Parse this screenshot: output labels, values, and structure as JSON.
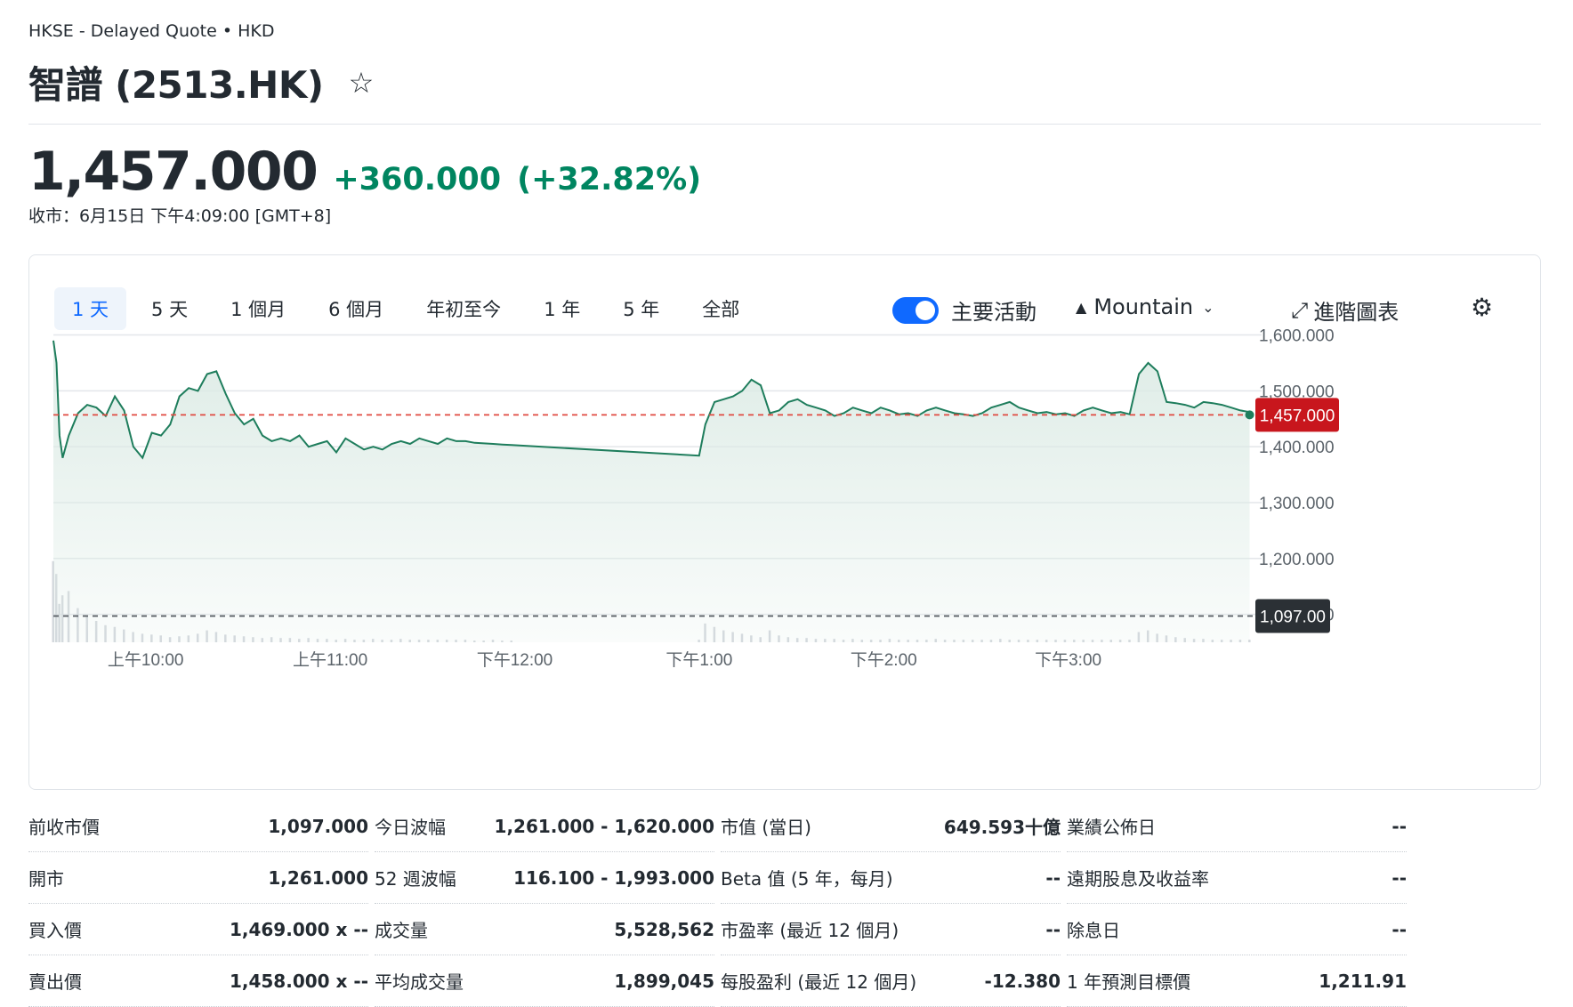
{
  "header": {
    "exchange_line": "HKSE - Delayed Quote • HKD",
    "title": "智譜 (2513.HK)",
    "star_icon": "star-outline-icon"
  },
  "quote": {
    "price": "1,457.000",
    "change": "+360.000",
    "change_pct": "(+32.82%)",
    "close_time": "收市：6月15日 下午4:09:00 [GMT+8]",
    "up_color": "#008560"
  },
  "chart_controls": {
    "ranges": [
      "1 天",
      "5 天",
      "1 個月",
      "6 個月",
      "年初至今",
      "1 年",
      "5 年",
      "全部"
    ],
    "active_range": "1 天",
    "key_events_label": "主要活動",
    "key_events_on": true,
    "chart_type_icon": "mountain-icon",
    "chart_type_label": "Mountain",
    "advanced_label": "進階圖表",
    "advanced_icon": "expand-arrow-icon",
    "settings_icon": "gear-icon"
  },
  "chart_data": {
    "type": "area",
    "x_labels": [
      "上午10:00",
      "上午11:00",
      "下午12:00",
      "下午1:00",
      "下午2:00",
      "下午3:00"
    ],
    "y_ticks": [
      "1,600.000",
      "1,500.000",
      "1,400.000",
      "1,300.000",
      "1,200.000",
      "1,100.000"
    ],
    "y_tick_values": [
      1600,
      1500,
      1400,
      1300,
      1200,
      1100
    ],
    "ylim": [
      1050,
      1620
    ],
    "current_price_label": "1,457.000",
    "current_price": 1457,
    "prev_close_label": "1,097.00",
    "prev_close": 1097,
    "line_color": "#1e7d5c",
    "fill_color": "#dcebe5",
    "current_badge_color": "#c8161d",
    "prev_badge_color": "#2b3035",
    "times": [
      "09:30",
      "09:31",
      "09:32",
      "09:33",
      "09:35",
      "09:38",
      "09:41",
      "09:44",
      "09:47",
      "09:50",
      "09:53",
      "09:56",
      "09:59",
      "10:02",
      "10:05",
      "10:08",
      "10:11",
      "10:14",
      "10:17",
      "10:20",
      "10:23",
      "10:26",
      "10:29",
      "10:32",
      "10:35",
      "10:38",
      "10:41",
      "10:44",
      "10:47",
      "10:50",
      "10:53",
      "10:56",
      "10:59",
      "11:02",
      "11:05",
      "11:08",
      "11:11",
      "11:14",
      "11:17",
      "11:20",
      "11:23",
      "11:26",
      "11:29",
      "11:32",
      "11:35",
      "11:38",
      "11:41",
      "11:44",
      "11:47",
      "11:50",
      "11:53",
      "11:56",
      "11:59",
      "13:00",
      "13:02",
      "13:05",
      "13:08",
      "13:11",
      "13:14",
      "13:17",
      "13:20",
      "13:23",
      "13:26",
      "13:29",
      "13:32",
      "13:35",
      "13:38",
      "13:41",
      "13:44",
      "13:47",
      "13:50",
      "13:53",
      "13:56",
      "13:59",
      "14:02",
      "14:05",
      "14:08",
      "14:11",
      "14:14",
      "14:17",
      "14:20",
      "14:23",
      "14:26",
      "14:29",
      "14:32",
      "14:35",
      "14:38",
      "14:41",
      "14:44",
      "14:47",
      "14:50",
      "14:53",
      "14:56",
      "14:59",
      "15:02",
      "15:05",
      "15:08",
      "15:11",
      "15:14",
      "15:17",
      "15:20",
      "15:23",
      "15:26",
      "15:29",
      "15:32",
      "15:35",
      "15:38",
      "15:41",
      "15:44",
      "15:47",
      "15:50",
      "15:53",
      "15:56",
      "15:59"
    ],
    "prices": [
      1590,
      1550,
      1420,
      1380,
      1420,
      1460,
      1475,
      1470,
      1455,
      1490,
      1465,
      1400,
      1380,
      1425,
      1420,
      1440,
      1490,
      1505,
      1500,
      1530,
      1535,
      1495,
      1460,
      1440,
      1450,
      1420,
      1410,
      1415,
      1410,
      1420,
      1400,
      1405,
      1410,
      1390,
      1415,
      1405,
      1395,
      1400,
      1395,
      1405,
      1410,
      1405,
      1415,
      1410,
      1405,
      1415,
      1410,
      1410,
      1407,
      1406,
      1405,
      1404,
      1403,
      1384,
      1440,
      1480,
      1485,
      1490,
      1500,
      1520,
      1510,
      1460,
      1465,
      1480,
      1485,
      1475,
      1470,
      1465,
      1455,
      1460,
      1470,
      1465,
      1460,
      1470,
      1465,
      1458,
      1460,
      1455,
      1465,
      1470,
      1465,
      1460,
      1458,
      1455,
      1460,
      1470,
      1475,
      1480,
      1470,
      1465,
      1460,
      1462,
      1458,
      1460,
      1455,
      1465,
      1470,
      1465,
      1460,
      1462,
      1458,
      1530,
      1550,
      1535,
      1480,
      1478,
      1475,
      1470,
      1480,
      1478,
      1475,
      1470,
      1465,
      1462,
      1460,
      1457
    ],
    "volumes": [
      95,
      80,
      45,
      55,
      60,
      40,
      30,
      25,
      20,
      18,
      15,
      12,
      10,
      9,
      8,
      6,
      7,
      8,
      10,
      14,
      12,
      9,
      8,
      7,
      6,
      5,
      6,
      5,
      5,
      4,
      5,
      4,
      4,
      3,
      4,
      3,
      3,
      4,
      3,
      3,
      4,
      3,
      3,
      3,
      3,
      3,
      3,
      3,
      2,
      2,
      3,
      2,
      2,
      3,
      22,
      18,
      14,
      12,
      10,
      8,
      6,
      14,
      8,
      6,
      5,
      5,
      4,
      4,
      4,
      3,
      4,
      3,
      3,
      3,
      4,
      3,
      3,
      3,
      3,
      4,
      3,
      3,
      3,
      3,
      3,
      3,
      4,
      3,
      3,
      3,
      3,
      3,
      3,
      3,
      3,
      3,
      3,
      3,
      3,
      3,
      3,
      12,
      14,
      10,
      8,
      6,
      5,
      4,
      4,
      3,
      3,
      3,
      3,
      3,
      4,
      5
    ]
  },
  "stats": {
    "col1": [
      {
        "label": "前收市價",
        "value": "1,097.000"
      },
      {
        "label": "開市",
        "value": "1,261.000"
      },
      {
        "label": "買入價",
        "value": "1,469.000 x --"
      },
      {
        "label": "賣出價",
        "value": "1,458.000 x --"
      }
    ],
    "col2": [
      {
        "label": "今日波幅",
        "value": "1,261.000 - 1,620.000"
      },
      {
        "label": "52 週波幅",
        "value": "116.100 - 1,993.000"
      },
      {
        "label": "成交量",
        "value": "5,528,562"
      },
      {
        "label": "平均成交量",
        "value": "1,899,045"
      }
    ],
    "col3": [
      {
        "label": "市值 (當日)",
        "value": "649.593十億"
      },
      {
        "label": "Beta 值 (5 年，每月)",
        "value": "--"
      },
      {
        "label": "市盈率 (最近 12 個月)",
        "value": "--"
      },
      {
        "label": "每股盈利 (最近 12 個月)",
        "value": "-12.380"
      }
    ],
    "col4": [
      {
        "label": "業績公佈日",
        "value": "--"
      },
      {
        "label": "遠期股息及收益率",
        "value": "--"
      },
      {
        "label": "除息日",
        "value": "--"
      },
      {
        "label": "1 年預測目標價",
        "value": "1,211.91"
      }
    ]
  }
}
